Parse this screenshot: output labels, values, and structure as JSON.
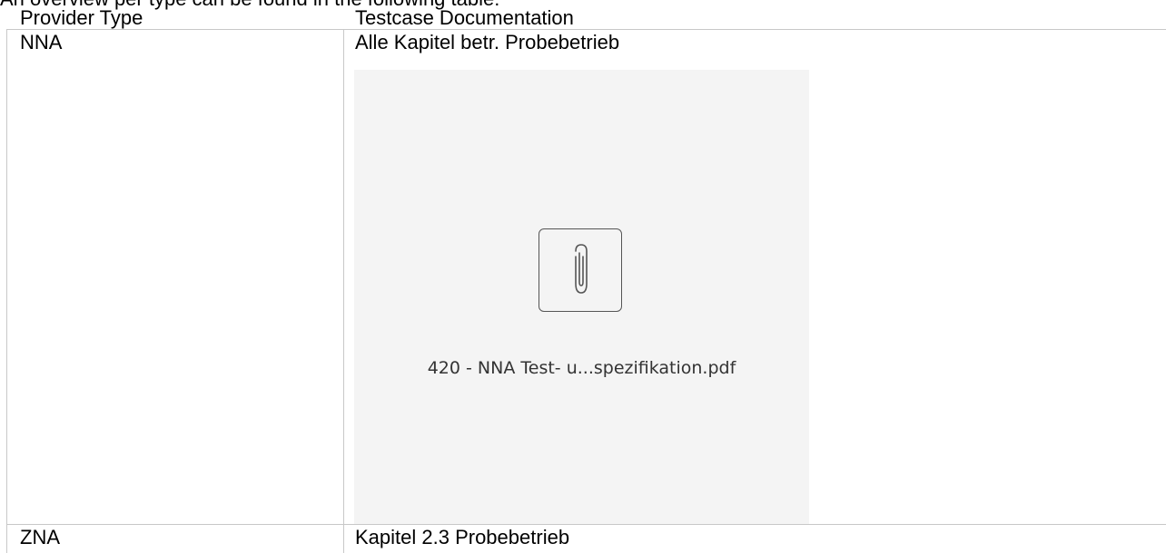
{
  "intro_text": "An overview per type can be found in the following table:",
  "table": {
    "headers": [
      "Provider Type",
      "Testcase Documentation"
    ],
    "rows": [
      {
        "provider": "NNA",
        "documentation": "Alle Kapitel betr. Probebetrieb"
      },
      {
        "provider": "ZNA",
        "documentation": "Kapitel 2.3 Probebetrieb"
      }
    ]
  },
  "attachment": {
    "icon": "paperclip-icon",
    "filename": "420 - NNA Test- u...spezifikation.pdf"
  }
}
